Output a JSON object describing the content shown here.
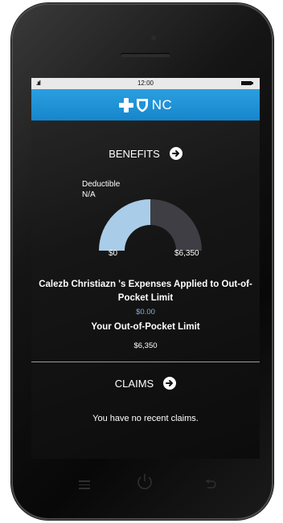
{
  "status_bar": {
    "signal": ".ııl",
    "time": "12:00"
  },
  "brand": {
    "name": "NC"
  },
  "benefits": {
    "title": "BENEFITS",
    "deductible_label": "Deductible",
    "deductible_value": "N/A",
    "gauge_min": "$0",
    "gauge_max": "$6,350",
    "expenses_label": "Calezb Christiazn 's Expenses Applied to Out-of-Pocket Limit",
    "expenses_value": "$0.00",
    "oop_limit_label": "Your Out-of-Pocket Limit",
    "oop_limit_value": "$6,350"
  },
  "claims": {
    "title": "CLAIMS",
    "empty_message": "You have no recent claims."
  },
  "colors": {
    "brand_blue": "#1e94d8",
    "gauge_filled": "#a9cce8",
    "gauge_empty": "#3e3e44",
    "accent_value": "#7fb2de"
  }
}
